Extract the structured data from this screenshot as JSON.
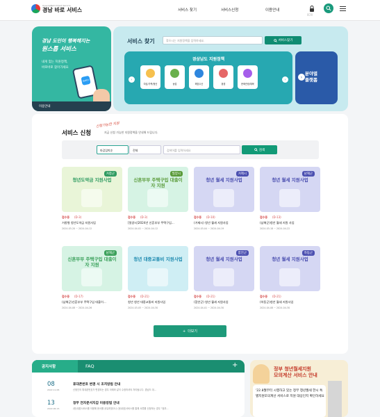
{
  "header": {
    "logo_sub": "GyeongNam Direct Service",
    "logo_main": "경남 바로 서비스",
    "nav": [
      "서비스 찾기",
      "서비스신청",
      "이용안내"
    ],
    "login_label": "로그인"
  },
  "hero": {
    "line1": "경남 도민이 행복해지는",
    "line2": "원스톱 서비스",
    "line3": "내게 맞는 지원정책,",
    "line4": "바로바로 찾아가세요",
    "phone_label": "BARO",
    "guide_label": "이용안내"
  },
  "service_search": {
    "title": "서비스 찾기",
    "placeholder": "찾으시는 지원정책을 입력하세요.",
    "button": "서비스찾기",
    "policy_title": "경상남도 지원정책",
    "policies": [
      {
        "label": "여성/가족/청년",
        "color": "#f6c04e"
      },
      {
        "label": "농업",
        "color": "#6ab04c"
      },
      {
        "label": "해양수산",
        "color": "#2e86de"
      },
      {
        "label": "환경",
        "color": "#e66767"
      },
      {
        "label": "문화관광/체육",
        "color": "#a55eea"
      }
    ],
    "shortcut_line1": "분야별",
    "shortcut_line2": "플랫폼"
  },
  "service_apply": {
    "title": "서비스 신청",
    "scribble": "신청가능한 지원",
    "desc": "지금 신청 가능한 지원정책을 안내해 드립니다.",
    "filter_status": "마감임박순",
    "filter_region": "전체",
    "search_placeholder": "검색어를 입력하세요",
    "search_button": "검색",
    "more_button": "더보기",
    "cards": [
      {
        "region": "거창군",
        "thumb_title": "청년도약금 지원사업",
        "bg": "#e9f5d8",
        "tag_color": "#2e9b60",
        "badge": "접수중",
        "dday": "(D-3)",
        "title": "거창형 청년도약금 지원사업",
        "date": "2024-03-20 ~ 2024-04-12"
      },
      {
        "region": "밀양시",
        "thumb_title": "신혼부부 주택구입 대출이자 지원",
        "bg": "#d6f3e4",
        "tag_color": "#5a9b3a",
        "badge": "접수중",
        "dday": "(D-3)",
        "title": "[밀양시]2024년 신혼부부 주택구입...",
        "date": "2024-04-01 ~ 2024-04-12"
      },
      {
        "region": "거제시",
        "thumb_title": "청년 월세 지원사업",
        "bg": "#d5d7f3",
        "tag_color": "#4b4fb0",
        "badge": "접수중",
        "dday": "(D-10)",
        "title": "(거제시) 청년 월세 지원사업",
        "date": "2024-03-04 ~ 2024-04-19"
      },
      {
        "region": "남해군",
        "thumb_title": "청년 월세 지원사업",
        "bg": "#d5d7f3",
        "tag_color": "#4b4fb0",
        "badge": "접수중",
        "dday": "(D-13)",
        "title": "(남해군)청년 월세 지원 사업",
        "date": "2024-03-18 ~ 2024-04-22"
      },
      {
        "region": "남해군",
        "thumb_title": "신혼부부 주택구입 대출이자 지원",
        "bg": "#d6f3e4",
        "tag_color": "#3aa05a",
        "badge": "접수중",
        "dday": "(D-17)",
        "title": "(남해군)신혼부부 주택구입 대출이...",
        "date": "2024-04-08 ~ 2024-04-26"
      },
      {
        "region": "",
        "thumb_title": "청년 대중교통비 지원사업",
        "bg": "#cfeef4",
        "tag_color": "#1f8bb0",
        "badge": "접수중",
        "dday": "(D-21)",
        "title": "청년 청년 대중교통비 지원사업",
        "date": "2024-03-05 ~ 2024-04-30"
      },
      {
        "region": "함안군",
        "thumb_title": "청년 월세 지원사업",
        "bg": "#d5d7f3",
        "tag_color": "#4b4fb0",
        "badge": "접수중",
        "dday": "(D-21)",
        "title": "(함안군) 청년 월세 지원사업",
        "date": "2024-04-01 ~ 2024-04-30"
      },
      {
        "region": "하동군",
        "thumb_title": "청년 월세 지원사업",
        "bg": "#d5d7f3",
        "tag_color": "#4b4fb0",
        "badge": "접수중",
        "dday": "(D-21)",
        "title": "(하동군)청년 월세 지원사업",
        "date": "2024-04-08 ~ 2024-04-30"
      }
    ]
  },
  "notice": {
    "tab_active": "공지사항",
    "tab_other": "FAQ",
    "plus": "+",
    "items": [
      {
        "day": "08",
        "date": "2022.11.08.",
        "title": "휴대폰번호 변경 시 조치방법 안내",
        "sub": "신청인의 휴대폰번호가 변경되는 경우 아래와 같이 수정하셔야 처리됩니다. 경남도 대..."
      },
      {
        "day": "13",
        "date": "2022.06.13.",
        "title": "정부 전자문서지갑 이용방법 안내",
        "sub": "(현)대표서비스를 이용해 문서를 공유하였으나 (현)대표서비스를 통해 서류를 신청하는 경우 \"정부..."
      }
    ]
  },
  "banner": {
    "line1": "정부 청년월세지원",
    "line2": "모의계산 서비스 안내",
    "body": "'22.8월부터 시행하고 있는 정부 청년월세 한시 특별지원모의계산 서비스로 지원 대상인지 확인하세요"
  },
  "colors": {
    "primary": "#1a8e71",
    "teal": "#34b7a2",
    "hero_bg": "#c7eaef",
    "navy": "#2a5aa8"
  }
}
